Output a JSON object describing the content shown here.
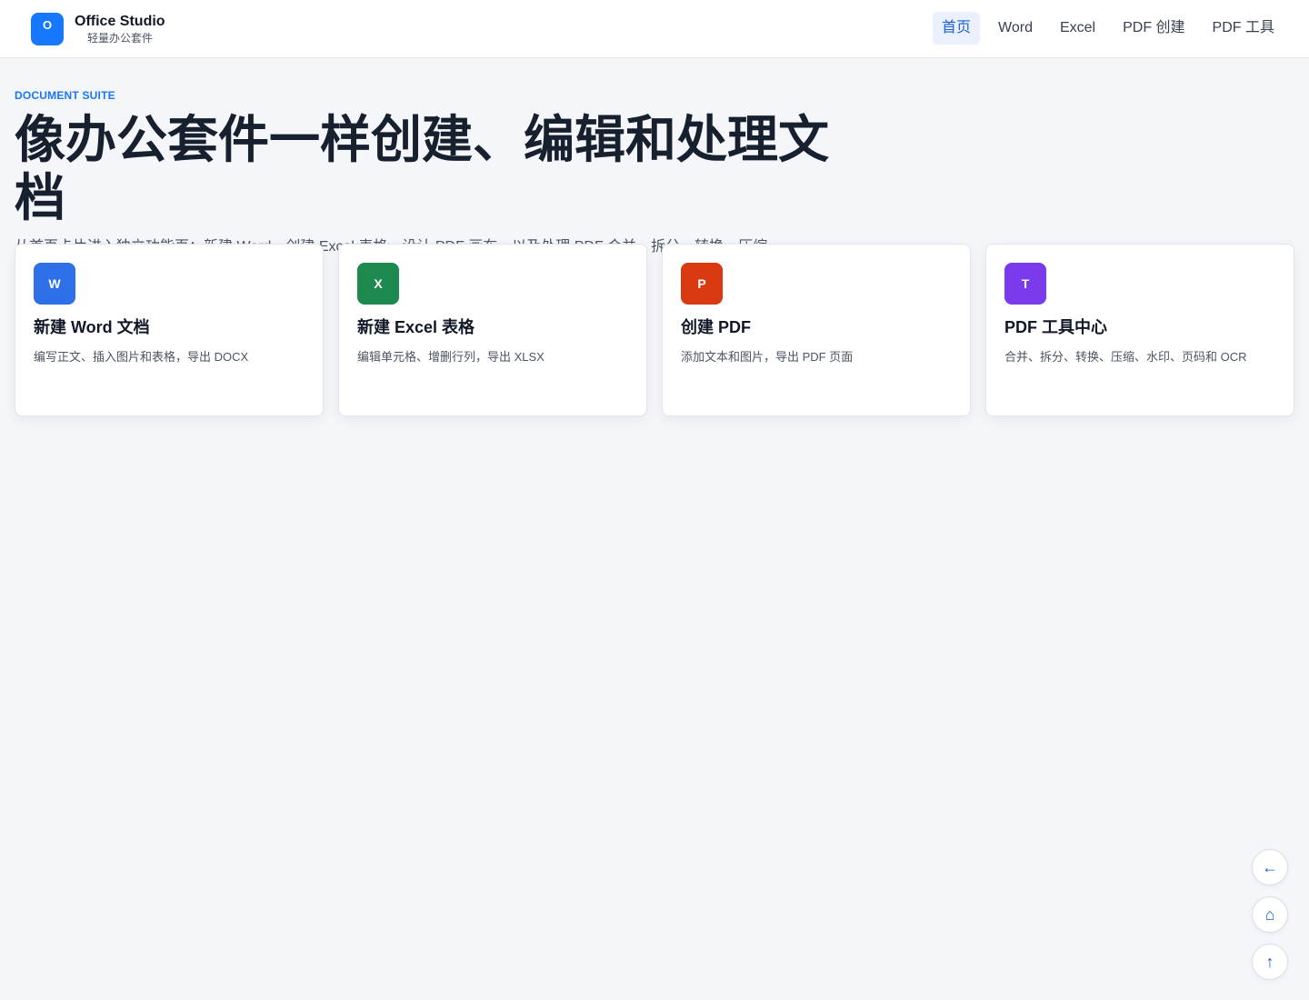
{
  "brand": {
    "logo_letter": "O",
    "name": "Office Studio",
    "subtitle": "轻量办公套件",
    "color": "#1677ff"
  },
  "nav": {
    "items": [
      {
        "label": "首页",
        "active": true
      },
      {
        "label": "Word",
        "active": false
      },
      {
        "label": "Excel",
        "active": false
      },
      {
        "label": "PDF 创建",
        "active": false
      },
      {
        "label": "PDF 工具",
        "active": false
      }
    ]
  },
  "hero": {
    "eyebrow": "DOCUMENT SUITE",
    "headline": "像办公套件一样创建、编辑和处理文档",
    "lead": "从首页卡片进入独立功能页：新建 Word、创建 Excel 表格、设计 PDF 画布，以及处理 PDF 合并、拆分、转换、压缩、水印和识别。"
  },
  "cards": [
    {
      "icon_letter": "W",
      "icon_color": "#2f6fe8",
      "title": "新建 Word 文档",
      "desc": "编写正文、插入图片和表格，导出 DOCX"
    },
    {
      "icon_letter": "X",
      "icon_color": "#1f8a50",
      "icon_name": "excel-icon",
      "title": "新建 Excel 表格",
      "desc": "编辑单元格、增删行列，导出 XLSX"
    },
    {
      "icon_letter": "P",
      "icon_color": "#d93a12",
      "title": "创建 PDF",
      "desc": "添加文本和图片，导出 PDF 页面"
    },
    {
      "icon_letter": "T",
      "icon_color": "#7c3aed",
      "title": "PDF 工具中心",
      "desc": "合并、拆分、转换、压缩、水印、页码和 OCR"
    }
  ],
  "floating": {
    "back_icon": "←",
    "home_icon": "⌂",
    "top_icon": "↑"
  }
}
